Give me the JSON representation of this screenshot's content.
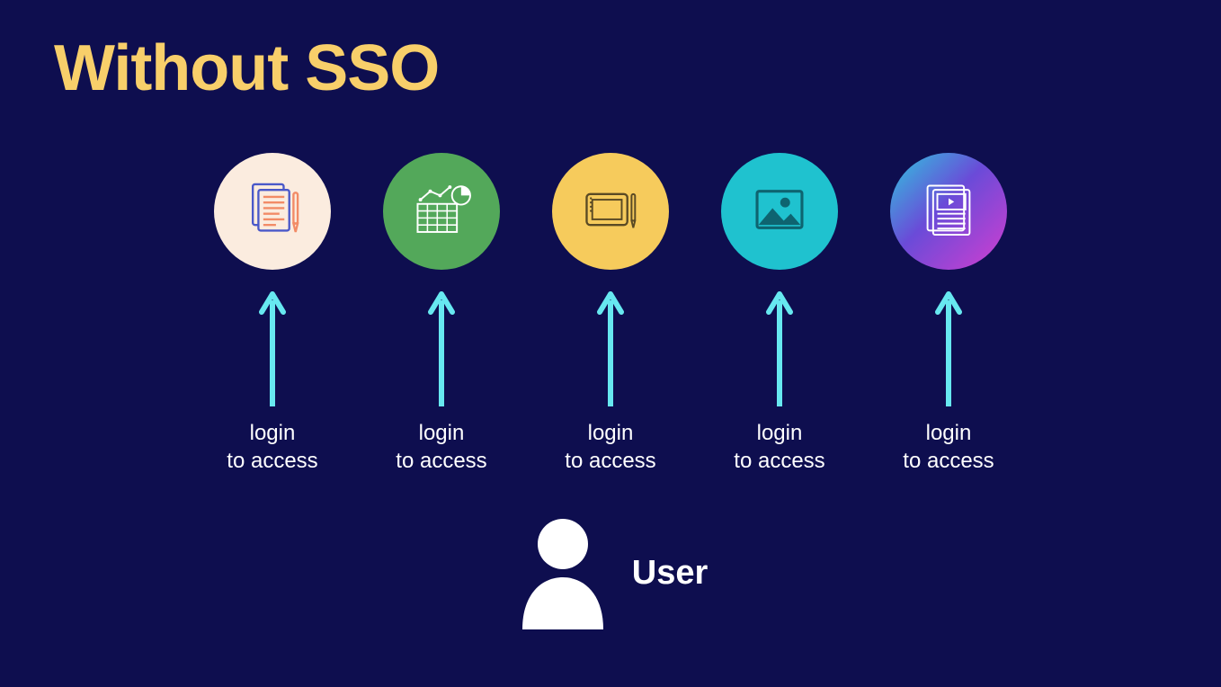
{
  "title": "Without SSO",
  "apps": [
    {
      "name": "documents-app",
      "icon": "documents-icon",
      "caption": "login\nto access",
      "color_class": "c1"
    },
    {
      "name": "analytics-app",
      "icon": "analytics-icon",
      "caption": "login\nto access",
      "color_class": "c2"
    },
    {
      "name": "tablet-app",
      "icon": "tablet-icon",
      "caption": "login\nto access",
      "color_class": "c3"
    },
    {
      "name": "image-app",
      "icon": "image-icon",
      "caption": "login\nto access",
      "color_class": "c4"
    },
    {
      "name": "media-app",
      "icon": "media-icon",
      "caption": "login\nto access",
      "color_class": "c5"
    }
  ],
  "user": {
    "label": "User"
  },
  "colors": {
    "background": "#0e0e4f",
    "title": "#f8cf6a",
    "arrow": "#67e8f0",
    "text": "#ffffff"
  }
}
